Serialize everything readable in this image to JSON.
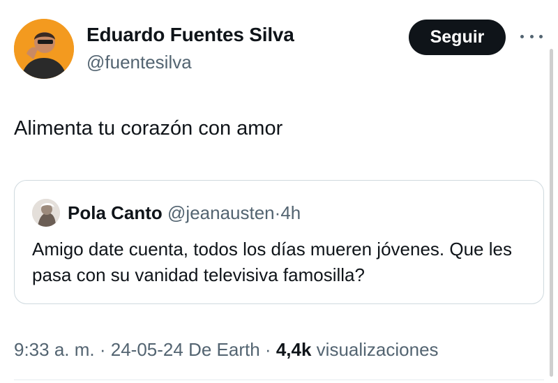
{
  "author": {
    "name": "Eduardo Fuentes Silva",
    "handle": "@fuentesilva",
    "avatar_color": "#f39a1f"
  },
  "follow_button": {
    "label": "Seguir"
  },
  "more_icon": "more-horizontal-icon",
  "tweet": {
    "text": "Alimenta tu corazón con amor"
  },
  "quoted_tweet": {
    "name": "Pola Canto",
    "handle": "@jeanausten",
    "separator": "·",
    "time": "4h",
    "text": "Amigo date cuenta, todos los días mueren jóvenes. Que les pasa con su vanidad televisiva famosilla?"
  },
  "meta": {
    "time": "9:33 a. m.",
    "sep1": "·",
    "date": "24-05-24",
    "source": "De Earth",
    "sep2": "·",
    "views_count": "4,4k",
    "views_label": "visualizaciones"
  },
  "colors": {
    "text": "#0f1419",
    "secondary": "#536471",
    "border": "#cfd9de",
    "button_bg": "#0f1419"
  }
}
